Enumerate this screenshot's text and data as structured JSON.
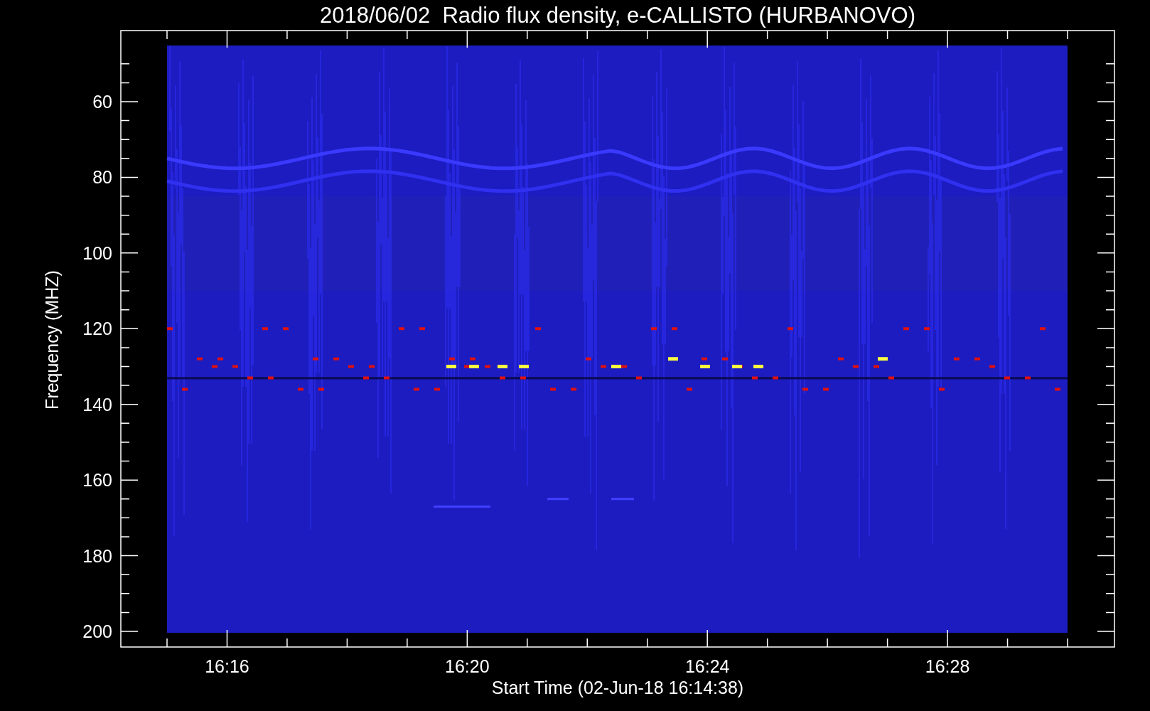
{
  "title": "2018/06/02  Radio flux density, e-CALLISTO (HURBANOVO)",
  "y_axis": {
    "label": "Frequency (MHZ)",
    "ticks": [
      "60",
      "80",
      "100",
      "120",
      "140",
      "160",
      "180",
      "200"
    ]
  },
  "x_axis": {
    "label": "Start Time (02-Jun-18 16:14:38)",
    "ticks": [
      "16:16",
      "16:20",
      "16:24",
      "16:28"
    ]
  }
}
